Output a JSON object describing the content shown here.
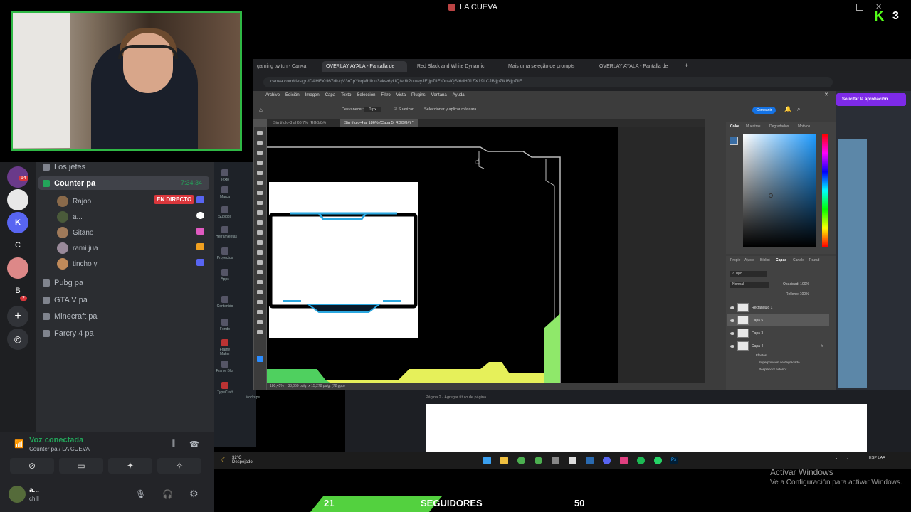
{
  "top": {
    "title": "LA CUEVA",
    "k_count": "3"
  },
  "discord": {
    "channels": [
      {
        "label": "Los jefes"
      },
      {
        "label": "Counter pa"
      },
      {
        "label": "Pubg pa"
      },
      {
        "label": "GTA V pa"
      },
      {
        "label": "Minecraft pa"
      },
      {
        "label": "Farcry 4 pa"
      }
    ],
    "timer": "7:34:34",
    "live_badge": "EN DIRECTO",
    "users": [
      {
        "name": "Rajoo"
      },
      {
        "name": "a..."
      },
      {
        "name": "Gitano"
      },
      {
        "name": "rami jua"
      },
      {
        "name": "tincho y"
      }
    ],
    "guild_badges": [
      "14",
      "2"
    ],
    "guild_letters": [
      "C",
      "B"
    ],
    "voice": {
      "title": "Voz conectada",
      "subtitle": "Counter pa / LA CUEVA"
    },
    "me": {
      "name": "a...",
      "status": "chill"
    }
  },
  "chrome": {
    "tabs": [
      "gaming twitch - Canva",
      "OVERLAY AYALA - Pantalla de",
      "Red Black and White Dynamic",
      "Mais uma seleção de prompts",
      "OVERLAY AYALA - Pantalla de"
    ],
    "url": "canva.com/design/DAHFXdl67dk/qV3rCpYoqMbIlou3akw6yUQ/edit?ui=eyJEIjp7IlEiOnsiQSI6dHJ1ZX19LCJBIjp7IkI6Ijp7IlE..."
  },
  "photoshop": {
    "menu": [
      "Archivo",
      "Edición",
      "Imagen",
      "Capa",
      "Texto",
      "Selección",
      "Filtro",
      "Vista",
      "Plugins",
      "Ventana",
      "Ayuda"
    ],
    "tabs": [
      "Sin título-3 al 66,7% (RGB/8#)",
      "Sin título-4 al 186% (Capa 5, RGB/8#) *"
    ],
    "options": {
      "label1": "Desvanecer:",
      "value1": "0 px",
      "label2": "Suavizar",
      "label3": "Seleccionar y aplicar máscara..."
    },
    "share": "Compartir",
    "status": "180,45%",
    "status2": "33,069 pulg. x 15,278 pulg. (72 ppp)",
    "panel_tabs": [
      "Propie",
      "Ajuste",
      "Bibliot",
      "Capas",
      "Canale",
      "Trazad"
    ],
    "color_tabs": [
      "Color",
      "Muestras",
      "Degradados",
      "Motivos"
    ],
    "layers": [
      {
        "name": "Rectángulo 1"
      },
      {
        "name": "Capa 5"
      },
      {
        "name": "Capa 3"
      },
      {
        "name": "Capa 4"
      }
    ],
    "effects": [
      "Efectos",
      "Superposición de degradado",
      "Resplandor exterior"
    ],
    "blend": "Normal",
    "opacity": "Opacidad: 100%",
    "fill": "Relleno: 100%"
  },
  "canva": {
    "page2": "Página 2 - Agregar título de página",
    "approval": "Solicitar la aprobación",
    "sidebar": [
      "Texto",
      "Marca",
      "Subidos",
      "Herramientas",
      "Proyectos",
      "Apps",
      "Contenido",
      "Fondo",
      "Frame Maker",
      "Frame Blur",
      "TypeCraft",
      "Mockups"
    ]
  },
  "taskbar": {
    "temp": "32°C",
    "weather": "Despejado",
    "lang": "ESP LAA"
  },
  "windows_activation": {
    "line1": "Activar Windows",
    "line2": "Ve a Configuración para activar Windows."
  },
  "followers": {
    "current": "21",
    "label": "SEGUIDORES",
    "goal": "50",
    "progress": 0.42
  },
  "colors": {
    "discord_green": "#23a55a",
    "kick_green": "#53fc18",
    "webcam_border": "#2fb845",
    "bar_green": "#53d13f",
    "live_red": "#da373c"
  }
}
